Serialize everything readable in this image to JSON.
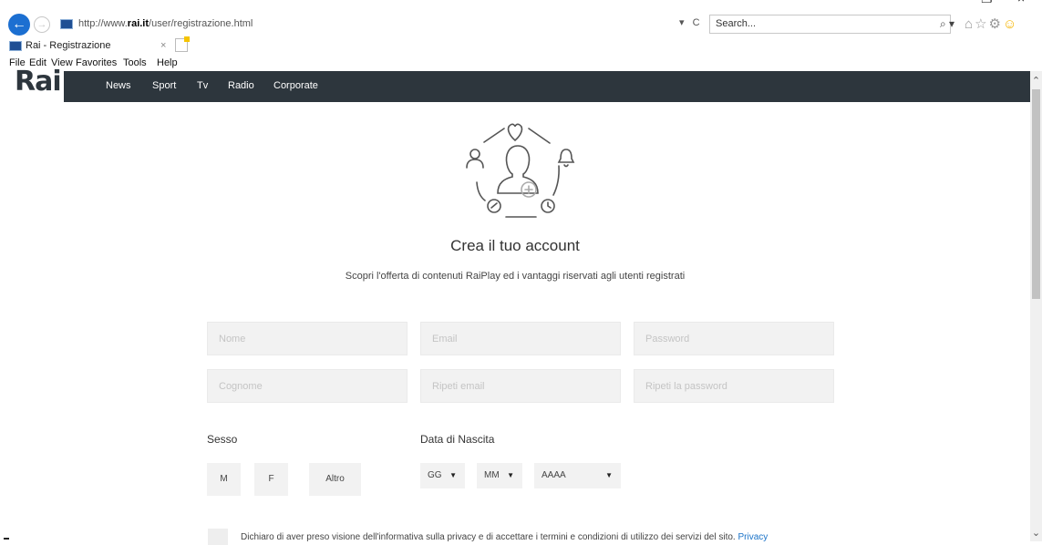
{
  "browser": {
    "url_prefix": "http://www.",
    "url_domain": "rai.it",
    "url_path": "/user/registrazione.html",
    "addr_dropdown": "▾",
    "refresh_glyph": "C",
    "search_placeholder": "Search...",
    "search_glyph": "⌕ ▾",
    "tab_title": "Rai - Registrazione",
    "tab_close": "×",
    "menu": [
      "File",
      "Edit",
      "View",
      "Favorites",
      "Tools",
      "Help"
    ],
    "window_controls": [
      "—",
      "❐",
      "×"
    ]
  },
  "site": {
    "logo": "Rai",
    "nav": [
      "News",
      "Sport",
      "Tv",
      "Radio",
      "Corporate"
    ]
  },
  "page": {
    "title": "Crea il tuo account",
    "subtitle": "Scopri l'offerta di contenuti RaiPlay ed i vantaggi riservati agli utenti registrati"
  },
  "form": {
    "nome": "Nome",
    "email": "Email",
    "password": "Password",
    "cognome": "Cognome",
    "ripeti_email": "Ripeti email",
    "ripeti_password": "Ripeti la password",
    "sesso_label": "Sesso",
    "sesso_options": [
      "M",
      "F",
      "Altro"
    ],
    "data_label": "Data di Nascita",
    "day": "GG",
    "month": "MM",
    "year": "AAAA",
    "caret": "▼",
    "consent_text": "Dichiaro di aver preso visione dell'informativa sulla privacy e di accettare i termini e condizioni di utilizzo dei servizi del sito.",
    "consent_link": "Privacy"
  },
  "colors": {
    "header_bg": "#2d363d",
    "link": "#1a73c8",
    "field_bg": "#f2f2f2",
    "back_button": "#1c6fd1"
  }
}
